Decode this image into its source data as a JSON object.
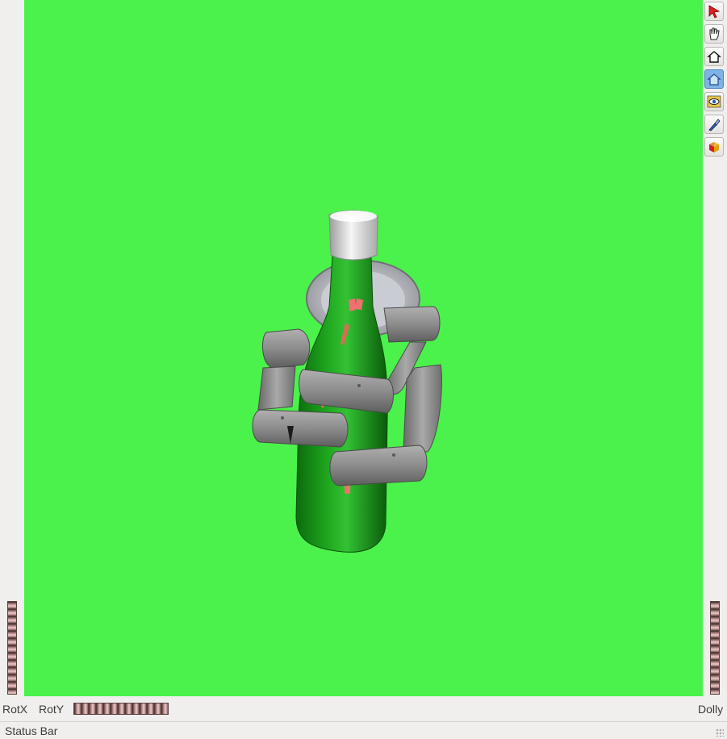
{
  "viewer": {
    "background_color": "#4bf24b",
    "scene_description_icon": "robot-hand-grasping-bottle"
  },
  "toolbar": {
    "buttons": [
      {
        "name": "select-arrow-icon",
        "active": false
      },
      {
        "name": "pan-hand-icon",
        "active": false
      },
      {
        "name": "home-icon",
        "active": false
      },
      {
        "name": "set-home-icon",
        "active": true
      },
      {
        "name": "view-all-eye-icon",
        "active": false
      },
      {
        "name": "seek-flashlight-icon",
        "active": false
      },
      {
        "name": "projection-cube-icon",
        "active": false
      }
    ]
  },
  "controls": {
    "rotx_label": "RotX",
    "roty_label": "RotY",
    "dolly_label": "Dolly"
  },
  "status": {
    "text": "Status Bar"
  }
}
